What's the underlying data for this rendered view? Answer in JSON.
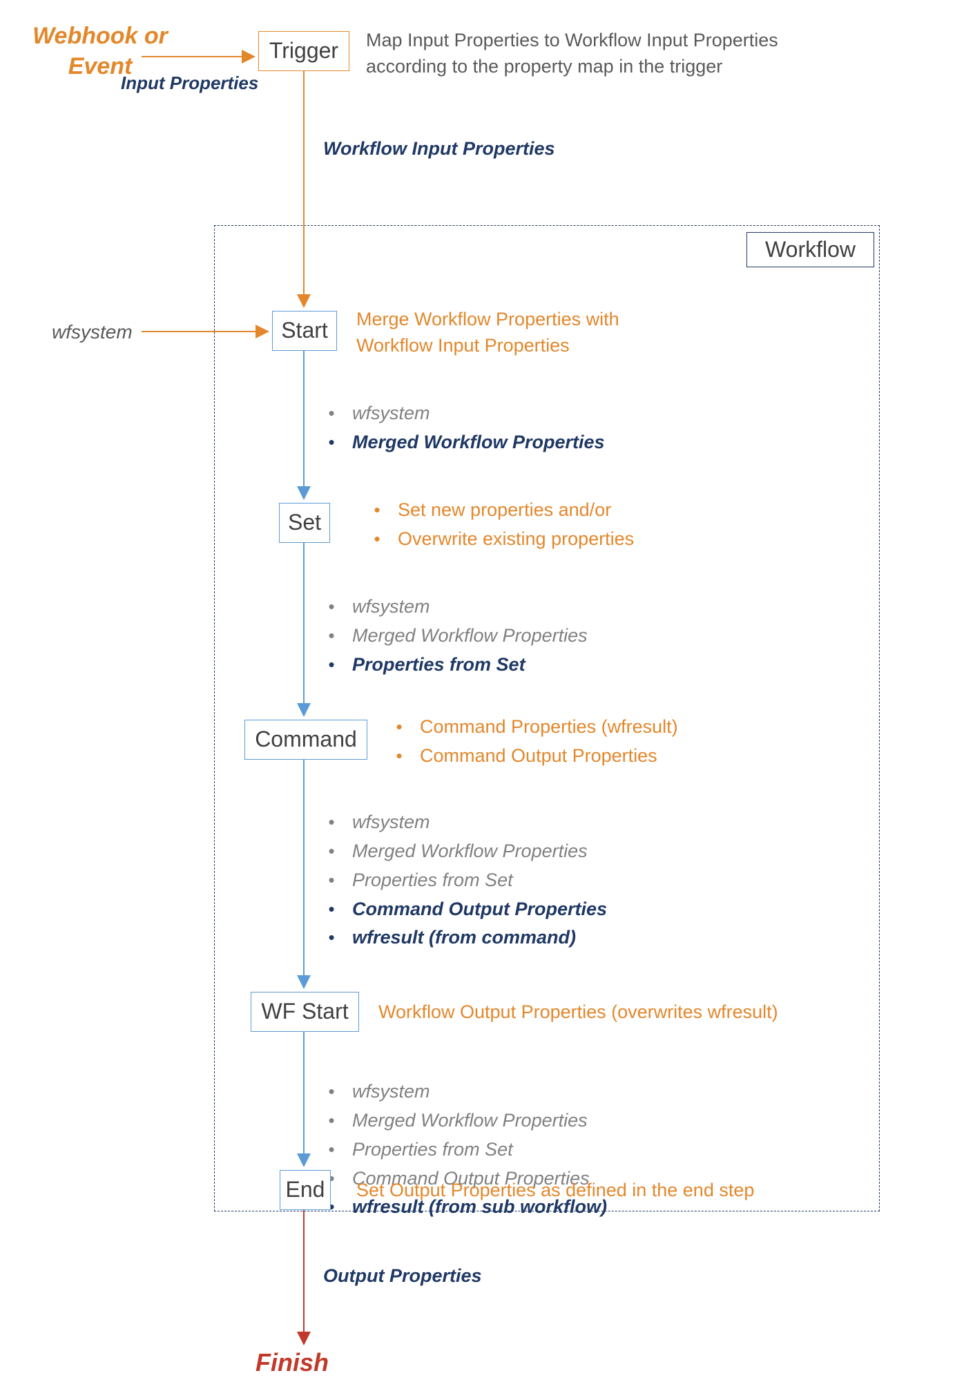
{
  "colors": {
    "orange": "#E3872B",
    "blue_accent": "#5B9BD5",
    "navy": "#1F3864",
    "grey": "#808080",
    "dark_red": "#A52A2A"
  },
  "webhook_label": "Webhook or\nEvent",
  "input_props_label": "Input Properties",
  "trigger": {
    "label": "Trigger",
    "desc": "Map Input Properties to Workflow Input Properties according to the property map in the trigger"
  },
  "workflow_container_label": "Workflow",
  "wf_input_props_label": "Workflow Input Properties",
  "wfsystem_label": "wfsystem",
  "start": {
    "label": "Start",
    "desc": "Merge Workflow Properties with Workflow Input Properties"
  },
  "after_start_props": [
    {
      "text": "wfsystem",
      "strong": false
    },
    {
      "text": "Merged Workflow Properties",
      "strong": true
    }
  ],
  "set": {
    "label": "Set",
    "desc_lines": [
      "Set new properties and/or",
      "Overwrite existing properties"
    ]
  },
  "after_set_props": [
    {
      "text": "wfsystem",
      "strong": false
    },
    {
      "text": "Merged Workflow Properties",
      "strong": false
    },
    {
      "text": "Properties from Set",
      "strong": true
    }
  ],
  "command": {
    "label": "Command",
    "desc_lines": [
      "Command Properties (wfresult)",
      "Command Output Properties"
    ]
  },
  "after_command_props": [
    {
      "text": "wfsystem",
      "strong": false
    },
    {
      "text": "Merged Workflow Properties",
      "strong": false
    },
    {
      "text": "Properties from Set",
      "strong": false
    },
    {
      "text": "Command Output Properties",
      "strong": true
    },
    {
      "text": "wfresult (from command)",
      "strong": true
    }
  ],
  "wfstart": {
    "label": "WF Start",
    "desc": "Workflow Output Properties (overwrites wfresult)"
  },
  "after_wfstart_props": [
    {
      "text": "wfsystem",
      "strong": false
    },
    {
      "text": "Merged Workflow Properties",
      "strong": false
    },
    {
      "text": "Properties from Set",
      "strong": false
    },
    {
      "text": "Command Output Properties",
      "strong": false
    },
    {
      "text": "wfresult (from sub workflow)",
      "strong": true
    }
  ],
  "end": {
    "label": "End",
    "desc": "Set Output Properties as defined in the end step"
  },
  "output_props_label": "Output Properties",
  "finish_label": "Finish"
}
